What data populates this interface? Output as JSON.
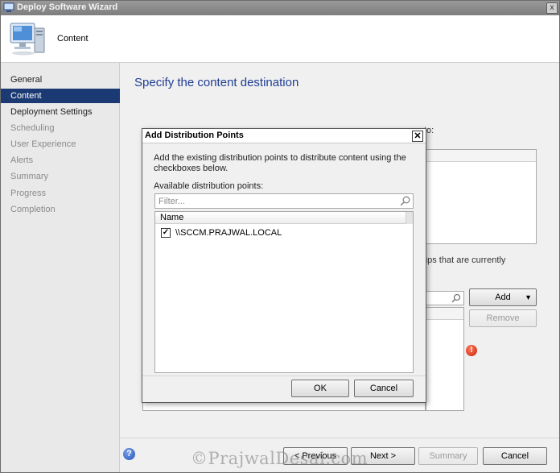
{
  "window": {
    "title": "Deploy Software Wizard",
    "close_glyph": "x"
  },
  "header": {
    "page_label": "Content",
    "icon": "computer-icon"
  },
  "sidebar": {
    "items": [
      {
        "label": "General",
        "state": "normal"
      },
      {
        "label": "Content",
        "state": "active"
      },
      {
        "label": "Deployment Settings",
        "state": "normal"
      },
      {
        "label": "Scheduling",
        "state": "dim"
      },
      {
        "label": "User Experience",
        "state": "dim"
      },
      {
        "label": "Alerts",
        "state": "dim"
      },
      {
        "label": "Summary",
        "state": "dim"
      },
      {
        "label": "Progress",
        "state": "dim"
      },
      {
        "label": "Completion",
        "state": "dim"
      }
    ]
  },
  "main": {
    "heading": "Specify the content destination",
    "background_instruction_tail": "to:",
    "background_text_2": "ups that are currently",
    "add_button": "Add",
    "remove_button": "Remove"
  },
  "dialog": {
    "title": "Add Distribution Points",
    "close_glyph": "✕",
    "instruction": "Add the existing distribution points to distribute content using the checkboxes below.",
    "list_label": "Available distribution points:",
    "filter_placeholder": "Filter...",
    "column_header": "Name",
    "rows": [
      {
        "name": "\\\\SCCM.PRAJWAL.LOCAL",
        "checked": true
      }
    ],
    "ok_button": "OK",
    "cancel_button": "Cancel"
  },
  "footer": {
    "previous_button": "< Previous",
    "next_button": "Next >",
    "summary_button": "Summary",
    "cancel_button": "Cancel"
  },
  "watermark": "©PrajwalDesai.com",
  "colors": {
    "accent_heading": "#1f3d91",
    "sidebar_active": "#1b3a74",
    "error": "#c8200a",
    "help": "#1d4fb8"
  }
}
